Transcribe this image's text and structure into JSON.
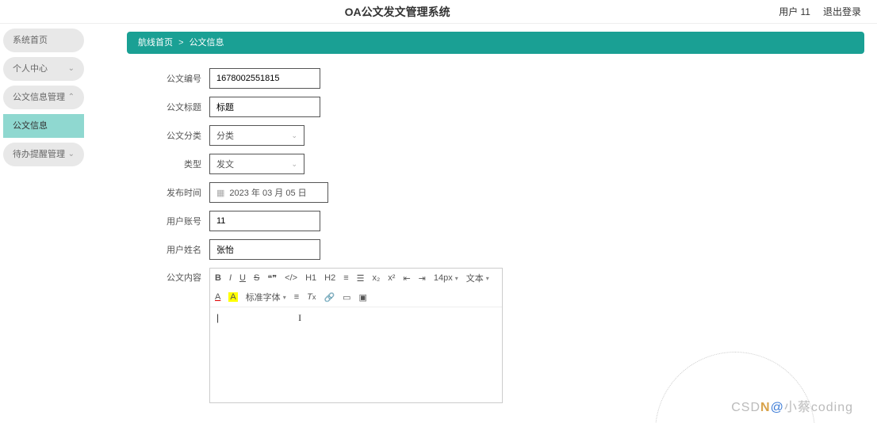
{
  "header": {
    "system_title": "OA公文发文管理系统",
    "user_label": "用户 11",
    "logout_label": "退出登录"
  },
  "sidebar": {
    "items": [
      {
        "label": "系统首页",
        "expandable": false
      },
      {
        "label": "个人中心",
        "expandable": true
      },
      {
        "label": "公文信息管理",
        "expandable": true
      },
      {
        "label": "公文信息",
        "expandable": false,
        "active": true
      },
      {
        "label": "待办提醒管理",
        "expandable": true
      }
    ]
  },
  "breadcrumb": {
    "home": "航线首页",
    "sep": ">",
    "current": "公文信息"
  },
  "form": {
    "doc_no": {
      "label": "公文编号",
      "value": "1678002551815"
    },
    "title": {
      "label": "公文标题",
      "value": "标题"
    },
    "category": {
      "label": "公文分类",
      "value": "分类"
    },
    "type": {
      "label": "类型",
      "value": "发文"
    },
    "publish_time": {
      "label": "发布时间",
      "value": "2023 年 03 月 05 日"
    },
    "user_account": {
      "label": "用户账号",
      "value": "11"
    },
    "user_name": {
      "label": "用户姓名",
      "value": "张怡"
    },
    "content": {
      "label": "公文内容"
    }
  },
  "editor_toolbar": {
    "font_size": "14px",
    "text_label": "文本",
    "font_family": "标准字体",
    "h1": "H1",
    "h2": "H2",
    "x2": "x₂",
    "x2sup": "x²"
  },
  "watermark": {
    "prefix": "CSD",
    "mid": "N",
    "at": "@",
    "tail": "小蔡coding"
  }
}
